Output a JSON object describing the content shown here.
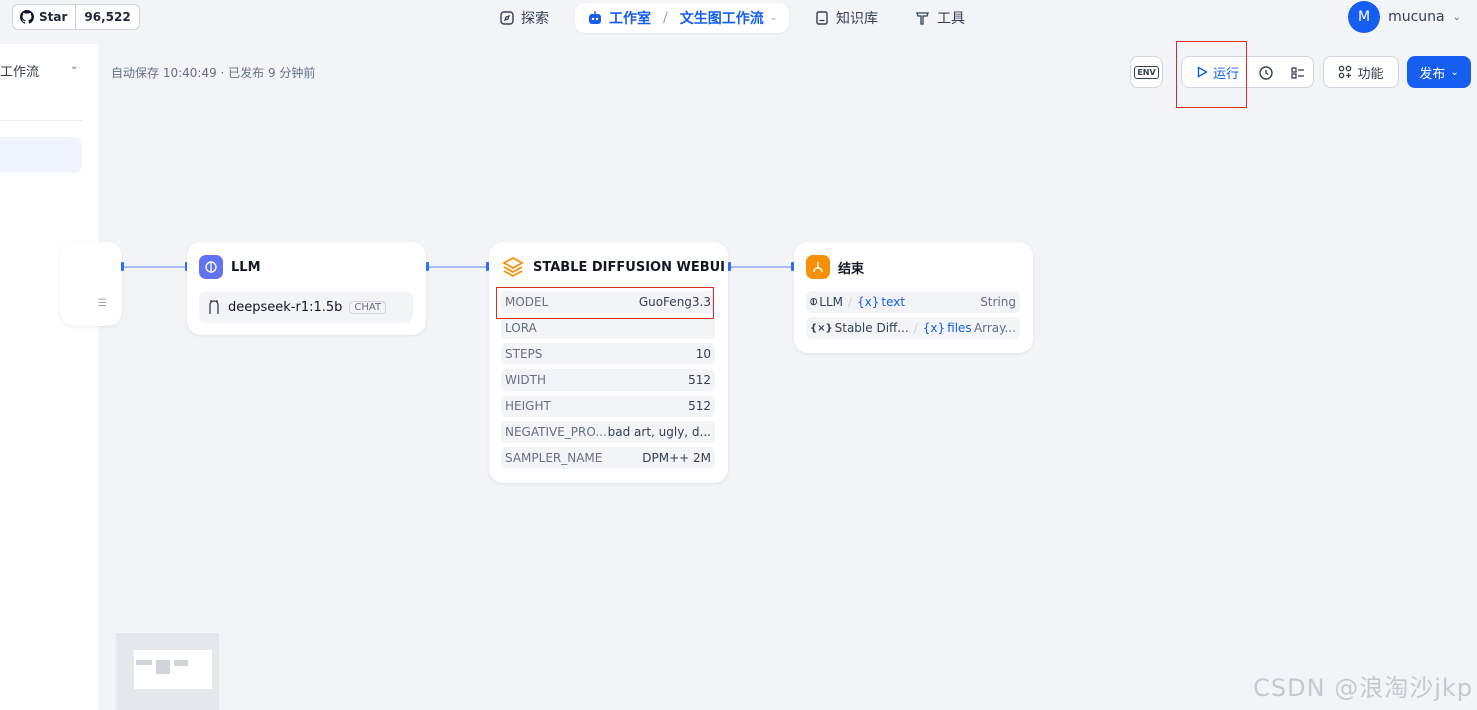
{
  "github": {
    "star_label": "Star",
    "count": "96,522"
  },
  "nav": {
    "explore": "探索",
    "studio": "工作室",
    "app_name": "文生图工作流",
    "knowledge": "知识库",
    "tools": "工具"
  },
  "user": {
    "initial": "M",
    "name": "mucuna"
  },
  "left_panel": {
    "app_name": "工作流"
  },
  "autosave_text": "自动保存 10:40:49 · 已发布 9 分钟前",
  "toolbar": {
    "env_label": "ENV",
    "run_label": "运行",
    "features_label": "功能",
    "publish_label": "发布"
  },
  "nodes": {
    "llm": {
      "title": "LLM",
      "model": "deepseek-r1:1.5b",
      "badge": "CHAT"
    },
    "sd": {
      "title": "STABLE DIFFUSION WEBUI",
      "params": [
        {
          "name": "MODEL",
          "value": "GuoFeng3.3"
        },
        {
          "name": "LORA",
          "value": ""
        },
        {
          "name": "STEPS",
          "value": "10"
        },
        {
          "name": "WIDTH",
          "value": "512"
        },
        {
          "name": "HEIGHT",
          "value": "512"
        },
        {
          "name": "NEGATIVE_PRO...",
          "value": "bad art, ugly, d..."
        },
        {
          "name": "SAMPLER_NAME",
          "value": "DPM++ 2M"
        }
      ]
    },
    "end": {
      "title": "结束",
      "outputs": [
        {
          "source": "LLM",
          "var": "text",
          "type": "String"
        },
        {
          "source": "Stable Diff...",
          "var": "files",
          "type": "Array..."
        }
      ]
    }
  },
  "watermark": "CSDN @浪淘沙jkp",
  "colors": {
    "primary": "#155eef",
    "highlight": "#d92d20",
    "sd_icon": "#f79009",
    "end_icon": "#f79009",
    "llm_icon": "#6172f3"
  }
}
